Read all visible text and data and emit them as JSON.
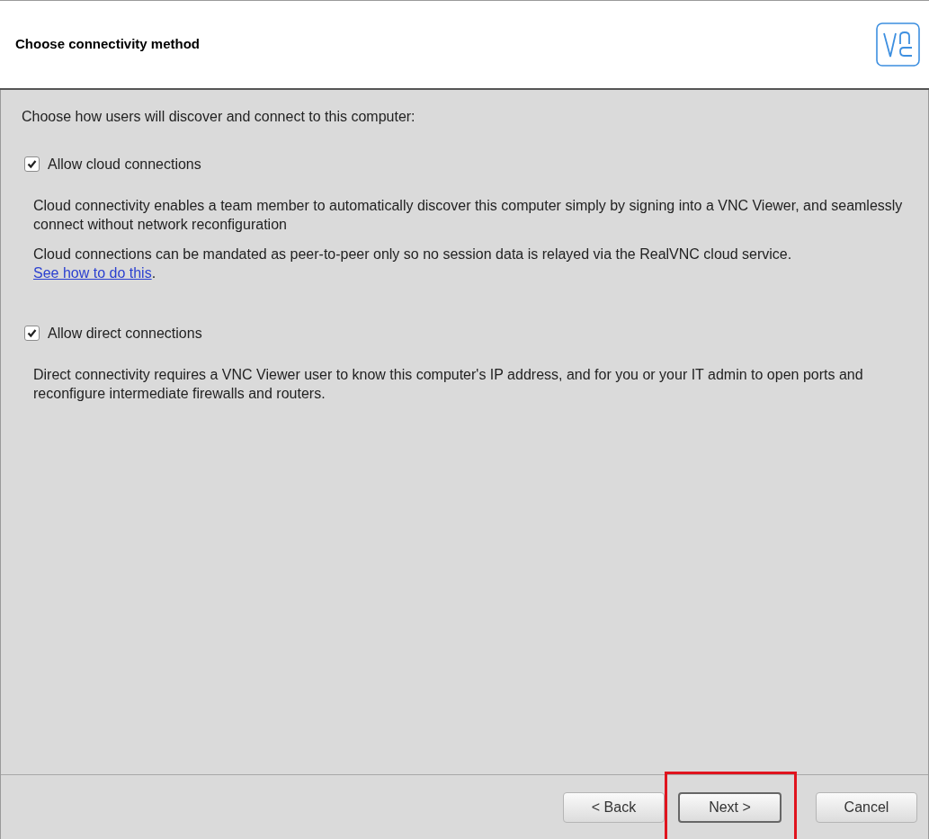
{
  "header": {
    "title": "Choose connectivity method"
  },
  "intro": "Choose how users will discover and connect to this computer:",
  "options": [
    {
      "label": "Allow cloud connections",
      "checked": true,
      "paragraphs": [
        {
          "text": "Cloud connectivity enables a team member to automatically discover this computer simply by signing into a VNC Viewer, and seamlessly connect without network reconfiguration"
        },
        {
          "text": "Cloud connections can be mandated as peer-to-peer only so no session data is relayed via the RealVNC cloud service.",
          "link": "See how to do this",
          "after": "."
        }
      ]
    },
    {
      "label": "Allow direct connections",
      "checked": true,
      "paragraphs": [
        {
          "text": "Direct connectivity requires a VNC Viewer user to know this computer's IP address, and for you or your IT admin to open ports and reconfigure intermediate firewalls and routers."
        }
      ]
    }
  ],
  "buttons": [
    {
      "label": "< Back",
      "default": false,
      "highlighted": false
    },
    {
      "label": "Next >",
      "default": true,
      "highlighted": true
    },
    {
      "label": "Cancel",
      "default": false,
      "highlighted": false
    }
  ]
}
